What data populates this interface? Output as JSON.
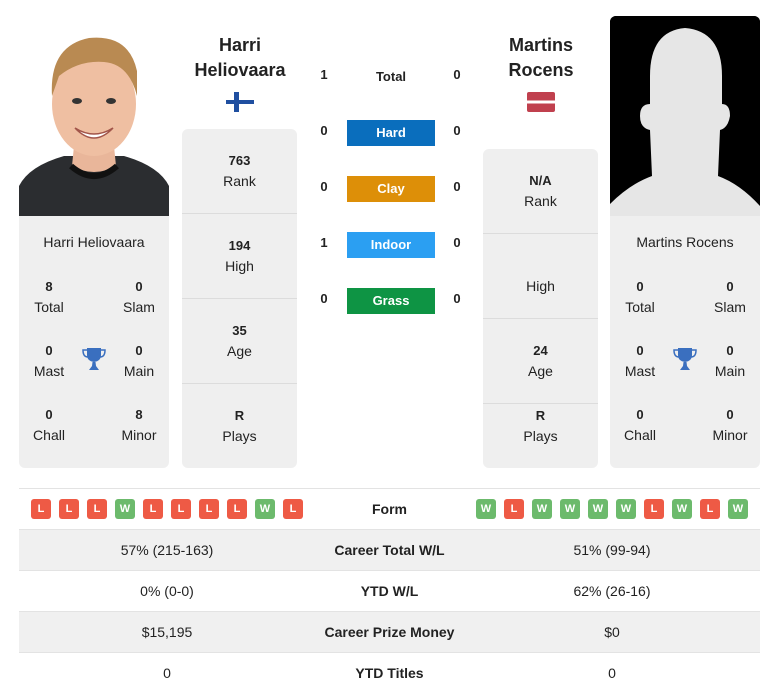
{
  "player1": {
    "name": "Harri Heliovaara",
    "name_line1": "Harri",
    "name_line2": "Heliovaara",
    "country_flag": "finland-flag",
    "titles": {
      "total": "8",
      "total_label": "Total",
      "slam": "0",
      "slam_label": "Slam",
      "mast": "0",
      "mast_label": "Mast",
      "main": "0",
      "main_label": "Main",
      "chall": "0",
      "chall_label": "Chall",
      "minor": "8",
      "minor_label": "Minor"
    },
    "info": {
      "rank": "763",
      "rank_label": "Rank",
      "high": "194",
      "high_label": "High",
      "age": "35",
      "age_label": "Age",
      "plays": "R",
      "plays_label": "Plays"
    },
    "form": [
      "L",
      "L",
      "L",
      "W",
      "L",
      "L",
      "L",
      "L",
      "W",
      "L"
    ]
  },
  "player2": {
    "name": "Martins Rocens",
    "name_line1": "Martins",
    "name_line2": "Rocens",
    "country_flag": "latvia-flag",
    "titles": {
      "total": "0",
      "total_label": "Total",
      "slam": "0",
      "slam_label": "Slam",
      "mast": "0",
      "mast_label": "Mast",
      "main": "0",
      "main_label": "Main",
      "chall": "0",
      "chall_label": "Chall",
      "minor": "0",
      "minor_label": "Minor"
    },
    "info": {
      "rank": "N/A",
      "rank_label": "Rank",
      "high": "",
      "high_label": "High",
      "age": "24",
      "age_label": "Age",
      "plays": "R",
      "plays_label": "Plays"
    },
    "form": [
      "W",
      "L",
      "W",
      "W",
      "W",
      "W",
      "L",
      "W",
      "L",
      "W"
    ]
  },
  "h2h": [
    {
      "label": "Total",
      "p1": "1",
      "p2": "0",
      "color": ""
    },
    {
      "label": "Hard",
      "p1": "0",
      "p2": "0",
      "color": "#0a6ebd"
    },
    {
      "label": "Clay",
      "p1": "0",
      "p2": "0",
      "color": "#dd8f08"
    },
    {
      "label": "Indoor",
      "p1": "1",
      "p2": "0",
      "color": "#2b9ff2"
    },
    {
      "label": "Grass",
      "p1": "0",
      "p2": "0",
      "color": "#0e9444"
    }
  ],
  "table": {
    "form_label": "Form",
    "rows": [
      {
        "label": "Career Total W/L",
        "p1": "57% (215-163)",
        "p2": "51% (99-94)"
      },
      {
        "label": "YTD W/L",
        "p1": "0% (0-0)",
        "p2": "62% (26-16)"
      },
      {
        "label": "Career Prize Money",
        "p1": "$15,195",
        "p2": "$0"
      },
      {
        "label": "YTD Titles",
        "p1": "0",
        "p2": "0"
      }
    ]
  },
  "colors": {
    "win": "#6cba6c",
    "loss": "#ee5a45",
    "trophy": "#3a6fbf"
  }
}
